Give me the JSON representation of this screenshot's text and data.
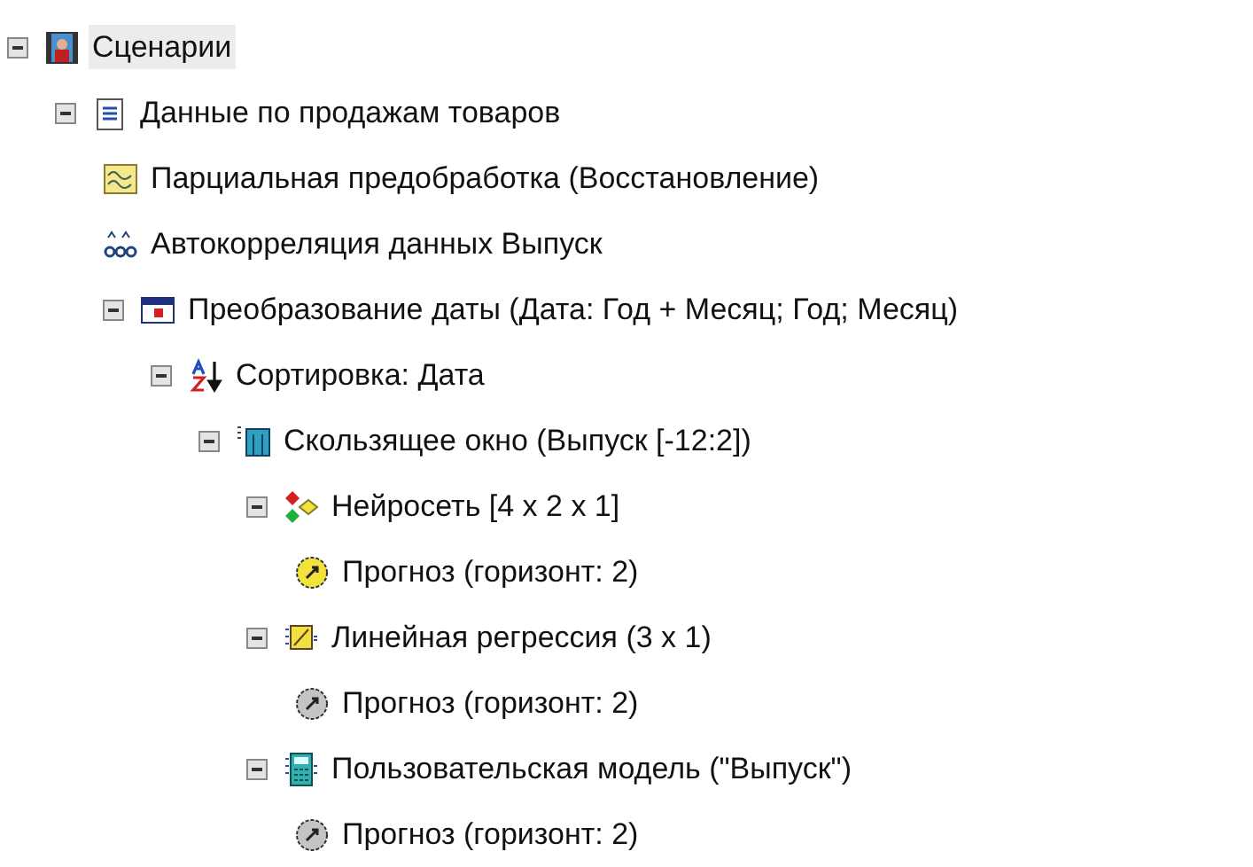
{
  "tree": [
    {
      "label": "Сценарии",
      "kind": "scenarios",
      "expanded": true,
      "selected": true,
      "children": [
        {
          "label": "Данные по продажам товаров",
          "kind": "dataset",
          "expanded": true,
          "selected": false,
          "children": [
            {
              "label": "Парциальная предобработка (Восстановление)",
              "kind": "preprocess",
              "selected": false
            },
            {
              "label": "Автокорреляция данных Выпуск",
              "kind": "autocorrelation",
              "selected": false
            },
            {
              "label": "Преобразование даты (Дата: Год + Месяц; Год; Месяц)",
              "kind": "date",
              "expanded": true,
              "selected": false,
              "children": [
                {
                  "label": "Сортировка: Дата",
                  "kind": "sort",
                  "expanded": true,
                  "selected": false,
                  "children": [
                    {
                      "label": "Скользящее окно (Выпуск [-12:2])",
                      "kind": "window",
                      "expanded": true,
                      "selected": false,
                      "children": [
                        {
                          "label": "Нейросеть [4 x 2 x 1]",
                          "kind": "neural",
                          "expanded": true,
                          "selected": false,
                          "children": [
                            {
                              "label": "Прогноз (горизонт: 2)",
                              "kind": "forecast",
                              "color": "#f2e33a",
                              "selected": false
                            }
                          ]
                        },
                        {
                          "label": "Линейная регрессия (3 x 1)",
                          "kind": "regression",
                          "expanded": true,
                          "selected": false,
                          "children": [
                            {
                              "label": "Прогноз (горизонт: 2)",
                              "kind": "forecast",
                              "color": "#c4c4c4",
                              "selected": false
                            }
                          ]
                        },
                        {
                          "label": "Пользовательская модель (\"Выпуск\")",
                          "kind": "custom",
                          "expanded": true,
                          "selected": false,
                          "children": [
                            {
                              "label": "Прогноз (горизонт: 2)",
                              "kind": "forecast",
                              "color": "#c4c4c4",
                              "selected": false
                            }
                          ]
                        }
                      ]
                    }
                  ]
                }
              ]
            }
          ]
        }
      ]
    }
  ]
}
